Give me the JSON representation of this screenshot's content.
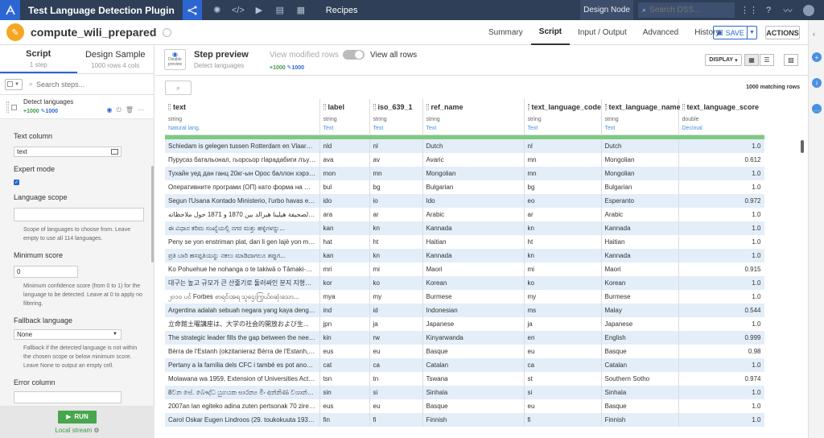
{
  "topbar": {
    "project_title": "Test Language Detection Plugin",
    "section": "Recipes",
    "node": "Design Node",
    "search_placeholder": "Search DSS..."
  },
  "recipe": {
    "name": "compute_wili_prepared",
    "tabs": [
      "Summary",
      "Script",
      "Input / Output",
      "Advanced",
      "History"
    ],
    "active_tab": "Script",
    "save_label": "SAVE",
    "actions_label": "ACTIONS"
  },
  "left_panel": {
    "tabs": [
      {
        "label": "Script",
        "sub": "1 step"
      },
      {
        "label": "Design Sample",
        "sub": "1000 rows 4 cols"
      }
    ],
    "search_placeholder": "Search steps...",
    "step": {
      "name": "Detect languages",
      "added": "1000",
      "edited": "1000"
    },
    "form": {
      "text_column_label": "Text column",
      "text_column_value": "text",
      "expert_mode_label": "Expert mode",
      "language_scope_label": "Language scope",
      "language_scope_help": "Scope of languages to choose from. Leave empty to use all 114 languages.",
      "min_score_label": "Minimum score",
      "min_score_value": "0",
      "min_score_help": "Minimum confidence score (from 0 to 1) for the language to be detected. Leave at 0 to apply no filtering.",
      "fallback_label": "Fallback language",
      "fallback_value": "None",
      "fallback_help": "Fallback if the detected language is not within the chosen scope or below minimum score. Leave None to output an empty cell.",
      "error_column_label": "Error column"
    },
    "run_label": "RUN",
    "engine_label": "Local stream"
  },
  "preview": {
    "disable_label": "Disable preview",
    "title": "Step preview",
    "subtitle": "Detect languages",
    "view_modified_label": "View modified rows",
    "added": "1000",
    "edited": "1000",
    "view_all_label": "View all rows",
    "display_label": "DISPLAY",
    "matching_rows": "1000 matching rows"
  },
  "table": {
    "columns": [
      {
        "name": "text",
        "type": "string",
        "meaning": "Natural lang."
      },
      {
        "name": "label",
        "type": "string",
        "meaning": "Text"
      },
      {
        "name": "iso_639_1",
        "type": "string",
        "meaning": "Text"
      },
      {
        "name": "ref_name",
        "type": "string",
        "meaning": "Text"
      },
      {
        "name": "text_language_code",
        "type": "string",
        "meaning": "Text"
      },
      {
        "name": "text_language_name",
        "type": "string",
        "meaning": "Text"
      },
      {
        "name": "text_language_score",
        "type": "double",
        "meaning": "Decimal"
      }
    ],
    "rows": [
      [
        "Schiedam is gelegen tussen Rotterdam en Vlaardingen...",
        "nld",
        "nl",
        "Dutch",
        "nl",
        "Dutch",
        "1.0"
      ],
      [
        "Пурусаз батальонал, гьорсьор гIарадабиги лъун, у...",
        "ava",
        "av",
        "Avaric",
        "mn",
        "Mongolian",
        "0.612"
      ],
      [
        "Тухайн үед дан ганц 20кг-ын Орос баллон хэрэглэ...",
        "mon",
        "mn",
        "Mongolian",
        "mn",
        "Mongolian",
        "1.0"
      ],
      [
        "Оперативните програми (ОП) като форма на фина...",
        "bul",
        "bg",
        "Bulgarian",
        "bg",
        "Bulgarian",
        "1.0"
      ],
      [
        "Segun l'Usana Kontado Ministerio, l'urbo havas ent...",
        "ido",
        "io",
        "Ido",
        "eo",
        "Esperanto",
        "0.972"
      ],
      [
        "المغْنَلة لصحيفة هيلينا هيرالد بين 1870 و 1871 حول ملاحظاته",
        "ara",
        "ar",
        "Arabic",
        "ar",
        "Arabic",
        "1.0"
      ],
      [
        "ಈ ವಿಧಾನ ಕರಿಮ ಸಂಖ್ಯೆಯಲ್ಲಿ ನಗರ ಮತ್ತು ಹಳ್ಳಿಗಳನ್ನು...",
        "kan",
        "kn",
        "Kannada",
        "kn",
        "Kannada",
        "1.0"
      ],
      [
        "Peny se yon enstriman plat, dan li gen lajè yon mili...",
        "hat",
        "ht",
        "Haitian",
        "ht",
        "Haitian",
        "1.0"
      ],
      [
        "ಪ್ರತಿ ಬಾರಿ ಹಸಪ್ಪತಿಯನ್ನು ನಕಲು ಮಾಡಿದಾಗಲೂ ತಪ್ಪುಗ...",
        "kan",
        "kn",
        "Kannada",
        "kn",
        "Kannada",
        "1.0"
      ],
      [
        "Ko Pohuehue he nohanga o te takiwā o Tāmaki-ma...",
        "mri",
        "mi",
        "Maori",
        "mi",
        "Maori",
        "0.915"
      ],
      [
        "대구는 높고 규모가 큰 산줄기로 둘러싸인 분지 지형이...",
        "kor",
        "ko",
        "Korean",
        "ko",
        "Korean",
        "1.0"
      ],
      [
        "၂၀၁၀ ပင် Forbes စာရင်းအရ သူဌေးကြွယ်ဝဆုံးသော...",
        "mya",
        "my",
        "Burmese",
        "my",
        "Burmese",
        "1.0"
      ],
      [
        "Argentina adalah sebuah negara yang kaya dengan...",
        "ind",
        "id",
        "Indonesian",
        "ms",
        "Malay",
        "0.544"
      ],
      [
        "立命館土曜講座は、大学の社会的開放および生...",
        "jpn",
        "ja",
        "Japanese",
        "ja",
        "Japanese",
        "1.0"
      ],
      [
        "The strategic leader fills the gap between the need ...",
        "kin",
        "rw",
        "Kinyarwanda",
        "en",
        "English",
        "0.999"
      ],
      [
        "Bèrra de l'Estanh (okzitanieraz Bèrra de l'Estanh, fr...",
        "eus",
        "eu",
        "Basque",
        "eu",
        "Basque",
        "0.98"
      ],
      [
        "Pertany a la família dels CFC i també es pot anome...",
        "cat",
        "ca",
        "Catalan",
        "ca",
        "Catalan",
        "1.0"
      ],
      [
        "Molawana wa 1959, Extension of Universities Act of...",
        "tsn",
        "tn",
        "Tswana",
        "st",
        "Southern Sotho",
        "0.974"
      ],
      [
        "8වන සේ. බෞද්ධ යුගයක සාරන්‍ය මිං අන්නිණ වශාන්ශිතීයි ආ...",
        "sin",
        "si",
        "Sinhala",
        "si",
        "Sinhala",
        "1.0"
      ],
      [
        "2007an lan egiteko adina zuten pertsonak 70 ziren, ...",
        "eus",
        "eu",
        "Basque",
        "eu",
        "Basque",
        "1.0"
      ],
      [
        "Carol Oskar Eugen Lindroos (29. toukokuuta 1930 P...",
        "fin",
        "fi",
        "Finnish",
        "fi",
        "Finnish",
        "1.0"
      ]
    ]
  }
}
